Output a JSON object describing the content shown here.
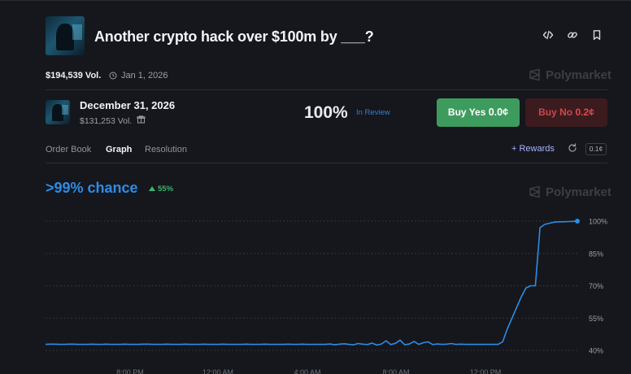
{
  "market": {
    "title": "Another crypto hack over $100m by ___?",
    "volume": "$194,539 Vol.",
    "end_date": "Jan 1, 2026",
    "brand": "Polymarket"
  },
  "outcome": {
    "title": "December 31, 2026",
    "volume": "$131,253 Vol.",
    "probability": "100%",
    "status": "In Review",
    "buy_yes_label": "Buy Yes",
    "buy_yes_price": "0.0¢",
    "buy_no_label": "Buy No",
    "buy_no_price": "0.2¢"
  },
  "tabs": [
    {
      "label": "Order Book",
      "active": false
    },
    {
      "label": "Graph",
      "active": true
    },
    {
      "label": "Resolution",
      "active": false
    }
  ],
  "toolbar": {
    "rewards_label": "+ Rewards",
    "spread": "0.1¢"
  },
  "summary": {
    "chance": ">99% chance",
    "change": "55%"
  },
  "icons": [
    "embed-icon",
    "link-icon",
    "bookmark-icon",
    "calendar-clock-icon",
    "gift-icon",
    "refresh-icon",
    "polymarket-logo-icon"
  ],
  "colors": {
    "accent_blue": "#2d8ce6",
    "yes_green": "#3e9b5e",
    "no_red": "#3b1b1e",
    "background": "#15171c"
  },
  "chart_data": {
    "type": "line",
    "x_tick_labels": [
      "8:00 PM",
      "12:00 AM",
      "4:00 AM",
      "8:00 AM",
      "12:00 PM"
    ],
    "y_tick_labels": [
      "100%",
      "85%",
      "70%",
      "55%",
      "40%"
    ],
    "ylim": [
      40,
      100
    ],
    "grid": true,
    "series": [
      {
        "values": [
          42.8,
          42.9,
          42.9,
          42.8,
          42.8,
          42.9,
          42.9,
          42.8,
          42.8,
          42.8,
          42.9,
          42.8,
          42.8,
          42.9,
          42.8,
          42.8,
          42.8,
          42.9,
          42.8,
          42.8,
          42.8,
          42.9,
          42.9,
          42.8,
          42.8,
          42.8,
          42.9,
          42.8,
          42.8,
          42.8,
          42.9,
          42.8,
          42.8,
          42.8,
          42.9,
          42.8,
          42.8,
          42.8,
          42.9,
          42.8,
          42.8,
          42.8,
          42.8,
          42.9,
          42.8,
          42.8,
          42.8,
          42.9,
          42.8,
          42.8,
          42.8,
          42.8,
          42.9,
          42.8,
          42.8,
          42.9,
          42.8,
          42.8,
          42.8,
          42.8,
          42.8,
          43.0,
          42.6,
          42.9,
          43.1,
          42.8,
          42.6,
          43.2,
          42.9,
          42.7,
          43.4,
          42.5,
          43.0,
          44.5,
          42.7,
          43.3,
          44.8,
          42.6,
          43.0,
          44.2,
          42.8,
          43.6,
          44.0,
          42.7,
          43.0,
          42.8,
          42.9,
          43.2,
          42.8,
          42.9,
          42.8,
          42.8,
          42.8,
          42.8,
          42.8,
          42.8,
          42.8,
          42.8,
          44.0,
          50.0,
          55.0,
          60.0,
          65.0,
          69.0,
          70.0,
          70.0,
          97.0,
          98.5,
          99.0,
          99.5,
          99.7,
          99.7,
          99.8,
          99.9,
          100.0
        ]
      }
    ]
  }
}
